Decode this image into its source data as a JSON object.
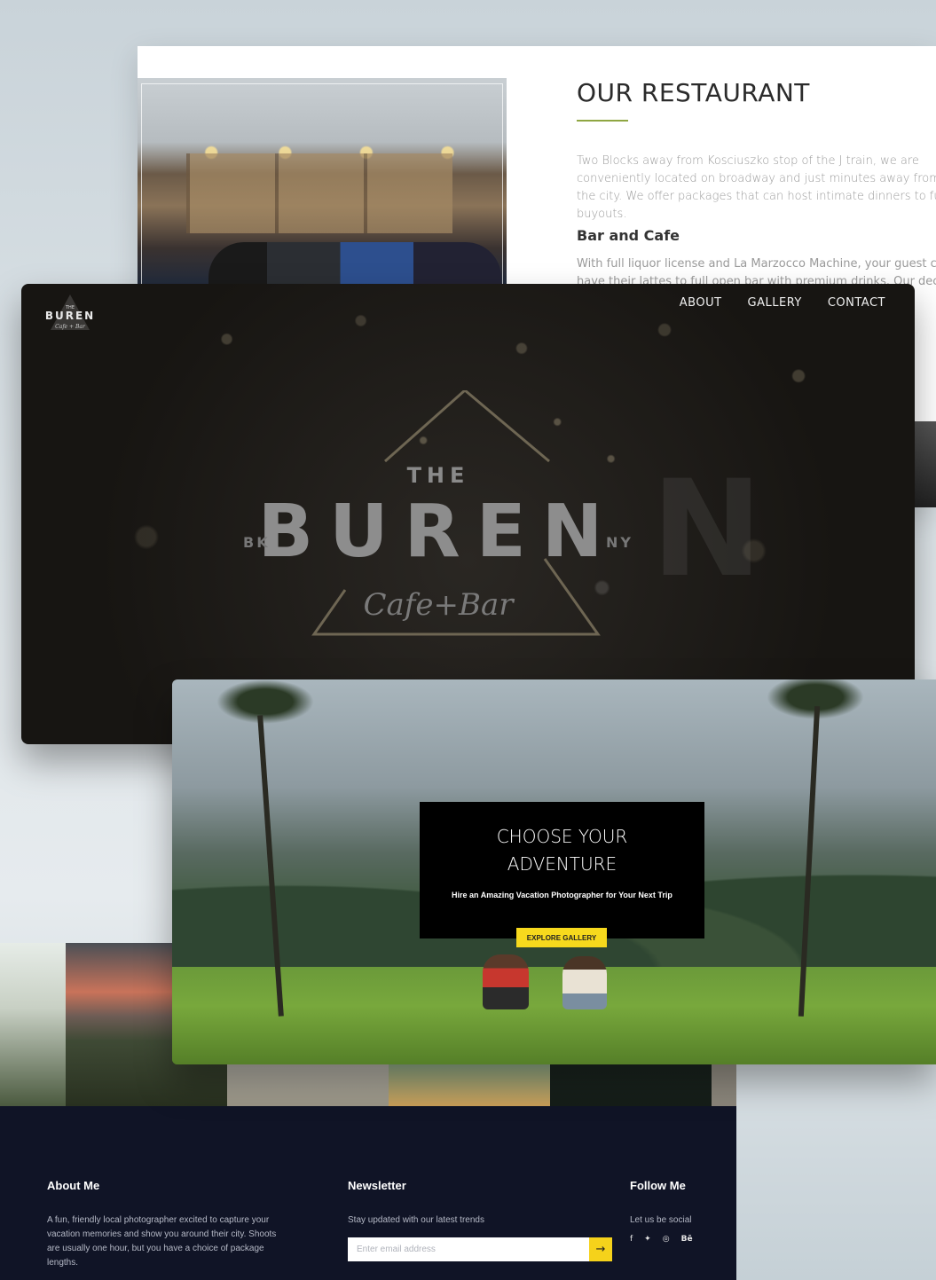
{
  "restaurant": {
    "title": "OUR RESTAURANT",
    "intro": "Two Blocks away from Kosciuszko stop of the J train, we are conveniently located on broadway and just minutes away from the city. We offer packages that can host intimate dinners to full buyouts.",
    "subheading": "Bar and Cafe",
    "sub_text": "With full liquor license and La Marzocco Machine, your guest can have their lattes to full open bar with premium drinks. Our decor and ambiance cowork",
    "accent_color": "#8fa642"
  },
  "buren": {
    "logo": {
      "the": "THE",
      "word": "BUREN",
      "script": "Cafe + Bar"
    },
    "nav": [
      "ABOUT",
      "GALLERY",
      "CONTACT"
    ],
    "hero": {
      "the": "THE",
      "word": "BUREN",
      "left": "BK",
      "right": "NY",
      "script": "Cafe+Bar"
    }
  },
  "adventure": {
    "title_line1": "CHOOSE YOUR",
    "title_line2": "ADVENTURE",
    "subtitle": "Hire an Amazing Vacation Photographer for Your Next Trip",
    "button": "EXPLORE GALLERY",
    "button_color": "#f7d91d"
  },
  "footer": {
    "about": {
      "heading": "About Me",
      "text": "A fun, friendly local photographer excited to capture your vacation memories and show you around their city. Shoots are usually one hour, but you have a choice of package lengths."
    },
    "newsletter": {
      "heading": "Newsletter",
      "text": "Stay updated with our latest trends",
      "placeholder": "Enter email address",
      "submit_icon": "arrow-right-icon"
    },
    "follow": {
      "heading": "Follow Me",
      "text": "Let us be social",
      "icons": [
        "facebook-icon",
        "twitter-icon",
        "dribbble-icon",
        "behance-icon"
      ]
    },
    "background_color": "#101426"
  }
}
